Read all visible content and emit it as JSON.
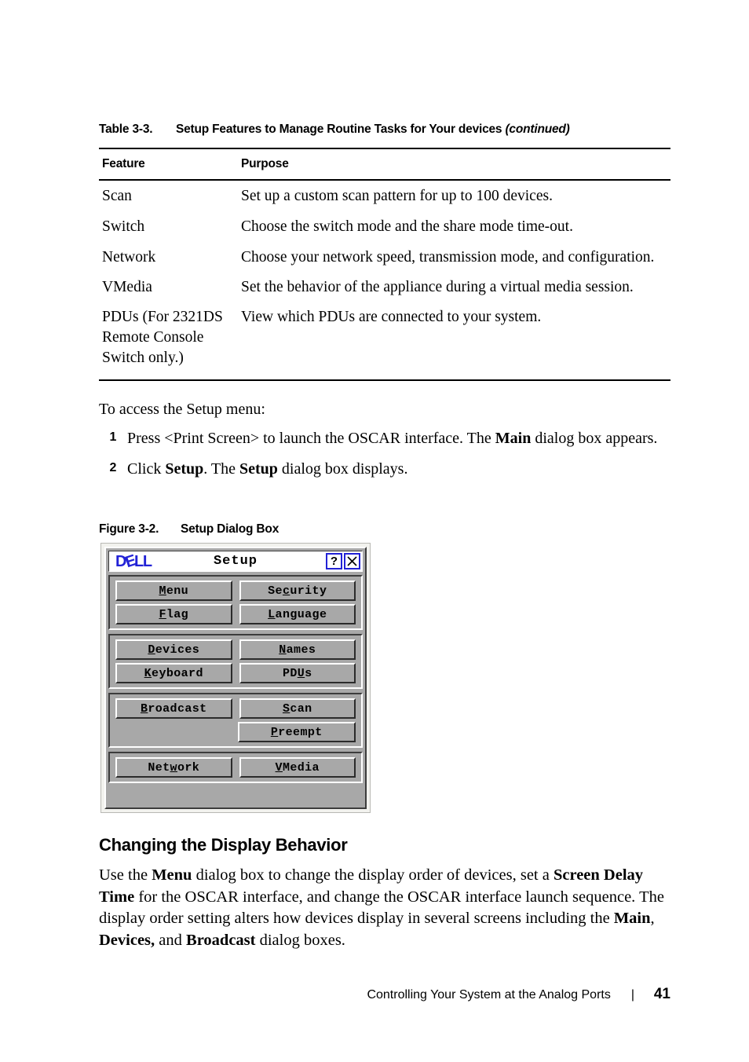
{
  "table": {
    "caption_number": "Table 3-3.",
    "caption_title": "Setup Features to Manage Routine Tasks for Your devices",
    "caption_continued": "(continued)",
    "headers": [
      "Feature",
      "Purpose"
    ],
    "rows": [
      {
        "feature": "Scan",
        "purpose": "Set up a custom scan pattern for up to 100 devices."
      },
      {
        "feature": "Switch",
        "purpose": "Choose the switch mode and the share mode time-out."
      },
      {
        "feature": "Network",
        "purpose": "Choose your network speed, transmission mode, and configuration."
      },
      {
        "feature": "VMedia",
        "purpose": "Set the behavior of the appliance during a virtual media session."
      },
      {
        "feature": "PDUs (For 2321DS Remote Console Switch only.)",
        "purpose": "View which PDUs are connected to your system."
      }
    ]
  },
  "access_intro": "To access the Setup menu:",
  "steps": [
    {
      "num": "1",
      "text_1": "Press <Print Screen> to launch the OSCAR interface. The ",
      "bold_1": "Main",
      "text_2": " dialog box appears."
    },
    {
      "num": "2",
      "text_1": "Click ",
      "bold_1": "Setup",
      "text_2": ". The ",
      "bold_2": "Setup",
      "text_3": " dialog box displays."
    }
  ],
  "figure": {
    "caption_number": "Figure 3-2.",
    "caption_title": "Setup Dialog Box"
  },
  "dialog": {
    "logo_text": "DELL",
    "logo_color": "#2222d6",
    "title": "Setup",
    "help_button": "?",
    "close_button": "X",
    "groups": [
      {
        "rows": [
          [
            {
              "label": "Menu",
              "pre": "",
              "mn": "M",
              "post": "enu"
            },
            {
              "label": "Security",
              "pre": "Se",
              "mn": "c",
              "post": "urity"
            }
          ],
          [
            {
              "label": "Flag",
              "pre": "",
              "mn": "F",
              "post": "lag"
            },
            {
              "label": "Language",
              "pre": "",
              "mn": "L",
              "post": "anguage"
            }
          ]
        ]
      },
      {
        "rows": [
          [
            {
              "label": "Devices",
              "pre": "",
              "mn": "D",
              "post": "evices"
            },
            {
              "label": "Names",
              "pre": "",
              "mn": "N",
              "post": "ames"
            }
          ],
          [
            {
              "label": "Keyboard",
              "pre": "",
              "mn": "K",
              "post": "eyboard"
            },
            {
              "label": "PDUs",
              "pre": "PD",
              "mn": "U",
              "post": "s"
            }
          ]
        ]
      },
      {
        "rows": [
          [
            {
              "label": "Broadcast",
              "pre": "",
              "mn": "B",
              "post": "roadcast"
            },
            {
              "label": "Scan",
              "pre": "",
              "mn": "S",
              "post": "can"
            }
          ],
          [
            {
              "label": "",
              "pre": "",
              "mn": "",
              "post": "",
              "empty": true
            },
            {
              "label": "Preempt",
              "pre": "",
              "mn": "P",
              "post": "reempt"
            }
          ]
        ]
      },
      {
        "rows": [
          [
            {
              "label": "Network",
              "pre": "Net",
              "mn": "w",
              "post": "ork"
            },
            {
              "label": "VMedia",
              "pre": "",
              "mn": "V",
              "post": "Media"
            }
          ]
        ]
      }
    ]
  },
  "section": {
    "heading": "Changing the Display Behavior",
    "body_parts": [
      {
        "t": "Use the ",
        "b": false
      },
      {
        "t": "Menu",
        "b": true
      },
      {
        "t": " dialog box to change the display order of devices, set a ",
        "b": false
      },
      {
        "t": "Screen Delay Time",
        "b": true
      },
      {
        "t": " for the OSCAR interface, and change the OSCAR interface launch sequence. The display order setting alters how devices display in several screens including the ",
        "b": false
      },
      {
        "t": "Main",
        "b": true
      },
      {
        "t": ", ",
        "b": false
      },
      {
        "t": "Devices,",
        "b": true
      },
      {
        "t": " and ",
        "b": false
      },
      {
        "t": "Broadcast",
        "b": true
      },
      {
        "t": " dialog boxes.",
        "b": false
      }
    ]
  },
  "footer": {
    "text": "Controlling Your System at the Analog Ports",
    "separator": "|",
    "page_number": "41"
  }
}
